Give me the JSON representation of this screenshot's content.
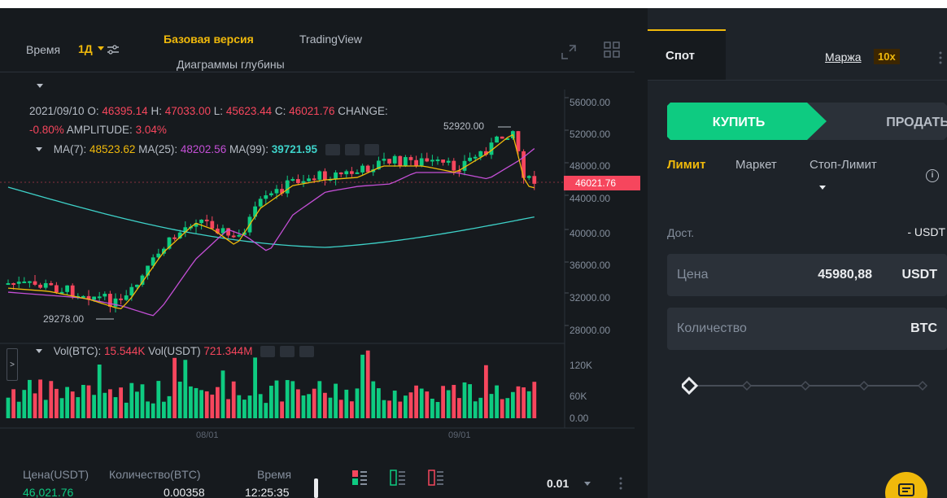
{
  "toolbar": {
    "time_label": "Время",
    "interval": "1Д",
    "tab_basic": "Базовая версия",
    "tab_tradingview": "TradingView",
    "tab_depth": "Диаграммы глубины"
  },
  "chart": {
    "ohlc": {
      "date": "2021/09/10",
      "o_label": "O:",
      "o": "46395.14",
      "h_label": "H:",
      "h": "47033.00",
      "l_label": "L:",
      "l": "45623.44",
      "c_label": "C:",
      "c": "46021.76",
      "change_label": "CHANGE:",
      "change": "-0.80%",
      "amplitude_label": "AMPLITUDE:",
      "amplitude": "3.04%"
    },
    "ma": {
      "ma7_label": "MA(7):",
      "ma7": "48523.62",
      "ma25_label": "MA(25):",
      "ma25": "48202.56",
      "ma99_label": "MA(99):",
      "ma99": "39721.95"
    },
    "volume": {
      "vol_btc_label": "Vol(BTC):",
      "vol_btc": "15.544K",
      "vol_usdt_label": "Vol(USDT)",
      "vol_usdt": "721.344M"
    },
    "price_axis": [
      "56000.00",
      "52000.00",
      "48000.00",
      "44000.00",
      "40000.00",
      "36000.00",
      "32000.00",
      "28000.00"
    ],
    "volume_axis": [
      "120K",
      "60K",
      "0.00"
    ],
    "last_price": "46021.76",
    "peak_label": "52920.00",
    "low_label": "29278.00",
    "dates": [
      "08/01",
      "09/01"
    ],
    "colors": {
      "up": "#0ecb81",
      "down": "#f6465d",
      "ma7": "#f0b90b",
      "ma25": "#c44fd6",
      "ma99": "#3ed2c9"
    }
  },
  "orderbook": {
    "col_price": "Цена(USDT)",
    "col_qty": "Количество(BTC)",
    "col_time": "Время",
    "rows": [
      {
        "price": "46,021.76",
        "qty": "0.00358",
        "time": "12:25:35"
      }
    ],
    "precision": "0.01"
  },
  "trade": {
    "tab_spot": "Спот",
    "tab_margin": "Маржа",
    "leverage": "10x",
    "buy": "КУПИТЬ",
    "sell": "ПРОДАТЬ",
    "order_types": [
      "Лимит",
      "Маркет",
      "Стоп-Лимит"
    ],
    "available_label": "Дост.",
    "available_value": "- USDT",
    "price_label": "Цена",
    "price_value": "45980,88",
    "price_unit": "USDT",
    "qty_label": "Количество",
    "qty_unit": "BTC"
  }
}
